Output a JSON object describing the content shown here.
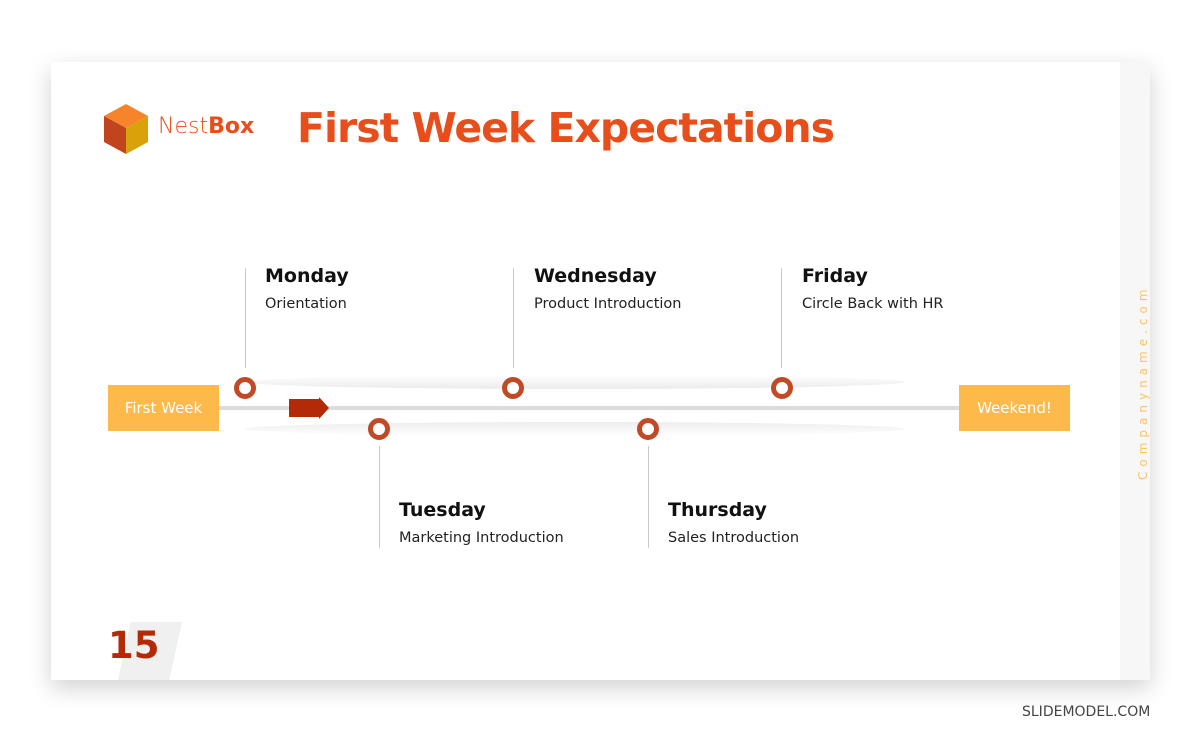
{
  "brand": {
    "name_light": "Nest",
    "name_bold": "Box",
    "color": "#e84e1b"
  },
  "title": "First Week Expectations",
  "timeline": {
    "start_label": "First Week",
    "end_label": "Weekend!",
    "accent_color": "#fdb94a",
    "node_color": "#c04a26",
    "arrow_color": "#b42a07",
    "days": [
      {
        "day": "Monday",
        "activity": "Orientation",
        "position": "top"
      },
      {
        "day": "Tuesday",
        "activity": "Marketing Introduction",
        "position": "bottom"
      },
      {
        "day": "Wednesday",
        "activity": "Product Introduction",
        "position": "top"
      },
      {
        "day": "Thursday",
        "activity": "Sales Introduction",
        "position": "bottom"
      },
      {
        "day": "Friday",
        "activity": "Circle Back with HR",
        "position": "top"
      }
    ]
  },
  "side_text": "Companyname.com",
  "page_number": "15",
  "footer": "SLIDEMODEL.COM"
}
